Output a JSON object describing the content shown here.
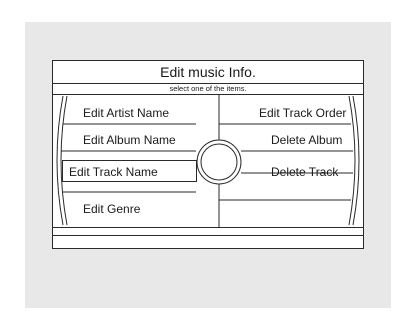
{
  "header": {
    "title": "Edit music Info.",
    "subtitle": "select one of the items."
  },
  "menu": {
    "left_items": [
      "Edit Artist Name",
      "Edit Album Name",
      "Edit Track Name",
      "Edit Genre"
    ],
    "right_items": [
      "Edit Track Order",
      "Delete Album",
      "Delete Track"
    ],
    "selected": "Edit Track Name"
  }
}
